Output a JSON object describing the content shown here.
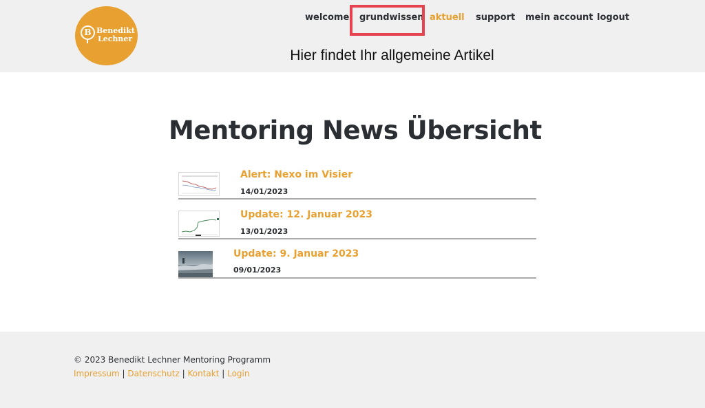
{
  "brand": {
    "logo_line1": "Benedikt",
    "logo_line2": "Lechner",
    "logo_symbol": "B",
    "accent_color": "#e8a031"
  },
  "nav": {
    "items": [
      {
        "label": "welcome"
      },
      {
        "label": "grundwissen",
        "highlighted": true
      },
      {
        "label": "aktuell",
        "active": true
      },
      {
        "label": "support"
      },
      {
        "label": "mein account"
      },
      {
        "label": "logout"
      }
    ],
    "highlight_color": "#e4434f"
  },
  "tagline": "Hier findet Ihr allgemeine Artikel",
  "main": {
    "title": "Mentoring News Übersicht",
    "posts": [
      {
        "title": "Alert: Nexo im Visier",
        "date": "14/01/2023",
        "thumbnail": "chart-thumbnail"
      },
      {
        "title": "Update: 12. Januar 2023",
        "date": "13/01/2023",
        "thumbnail": "chart-thumbnail"
      },
      {
        "title": "Update: 9. Januar 2023",
        "date": "09/01/2023",
        "thumbnail": "photo-thumbnail"
      }
    ]
  },
  "footer": {
    "copyright": "© 2023 Benedikt Lechner Mentoring Programm",
    "separator": "|",
    "links": [
      {
        "label": "Impressum"
      },
      {
        "label": "Datenschutz"
      },
      {
        "label": "Kontakt"
      },
      {
        "label": "Login"
      }
    ]
  }
}
